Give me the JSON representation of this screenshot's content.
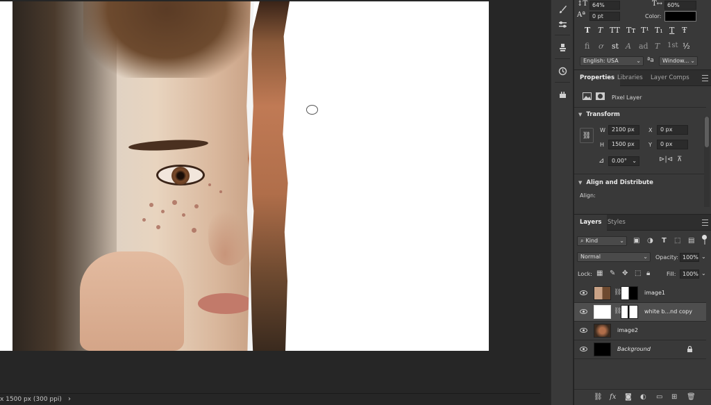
{
  "character": {
    "vscale": "64%",
    "hscale": "60%",
    "baseline": "0 pt",
    "color_label": "Color:",
    "glyphs_row1": [
      "T",
      "T",
      "TT",
      "Tт",
      "T¹",
      "T₁",
      "T",
      "Ŧ"
    ],
    "glyphs_row2": [
      "fi",
      "ơ",
      "st",
      "A",
      "ad",
      "T",
      "1st",
      "½"
    ],
    "language": "English: USA",
    "aa_symbol": "ªa",
    "antialias": "Window..."
  },
  "properties": {
    "tabs": [
      "Properties",
      "Libraries",
      "Layer Comps"
    ],
    "layer_type": "Pixel Layer",
    "transform_title": "Transform",
    "w_label": "W",
    "w_value": "2100 px",
    "h_label": "H",
    "h_value": "1500 px",
    "x_label": "X",
    "x_value": "0 px",
    "y_label": "Y",
    "y_value": "0 px",
    "angle": "0.00°",
    "align_title": "Align and Distribute",
    "align_label": "Align:"
  },
  "layers": {
    "tabs": [
      "Layers",
      "Styles"
    ],
    "filter": "Kind",
    "blend_mode": "Normal",
    "opacity_label": "Opacity:",
    "opacity": "100%",
    "lock_label": "Lock:",
    "fill_label": "Fill:",
    "fill": "100%",
    "items": [
      {
        "name": "image1",
        "selected": false
      },
      {
        "name": "white b...nd copy",
        "selected": true
      },
      {
        "name": "image2",
        "selected": false
      },
      {
        "name": "Background",
        "selected": false,
        "locked": true
      }
    ]
  },
  "status": {
    "doc_size": "x 1500 px (300 ppi)",
    "arrow": "›"
  }
}
